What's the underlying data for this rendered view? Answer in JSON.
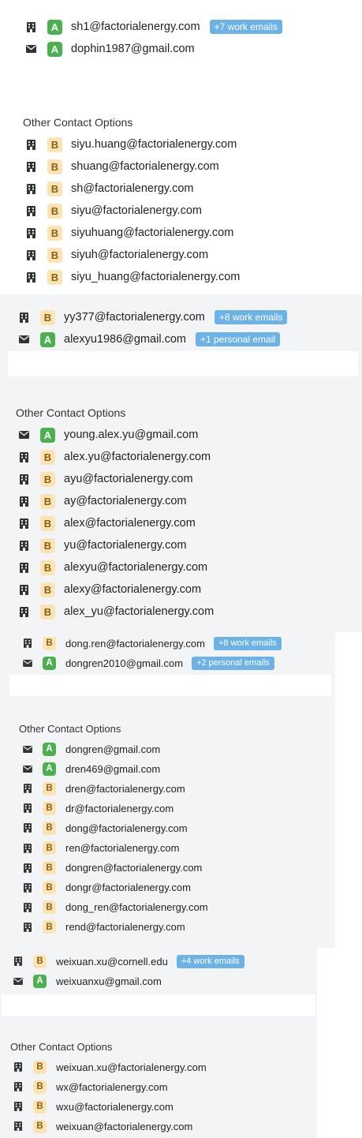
{
  "section_title": "Other Contact Options",
  "panels": [
    {
      "primary": [
        {
          "icon": "building-icon",
          "badge": "A",
          "email": "sh1@factorialenergy.com",
          "pill": "+7 work emails"
        },
        {
          "icon": "envelope-icon",
          "badge": "A",
          "email": "dophin1987@gmail.com",
          "pill": ""
        }
      ],
      "other": [
        {
          "icon": "building-icon",
          "badge": "B",
          "email": "siyu.huang@factorialenergy.com"
        },
        {
          "icon": "building-icon",
          "badge": "B",
          "email": "shuang@factorialenergy.com"
        },
        {
          "icon": "building-icon",
          "badge": "B",
          "email": "sh@factorialenergy.com"
        },
        {
          "icon": "building-icon",
          "badge": "B",
          "email": "siyu@factorialenergy.com"
        },
        {
          "icon": "building-icon",
          "badge": "B",
          "email": "siyuhuang@factorialenergy.com"
        },
        {
          "icon": "building-icon",
          "badge": "B",
          "email": "siyuh@factorialenergy.com"
        },
        {
          "icon": "building-icon",
          "badge": "B",
          "email": "siyu_huang@factorialenergy.com"
        }
      ]
    },
    {
      "primary": [
        {
          "icon": "building-icon",
          "badge": "B",
          "email": "yy377@factorialenergy.com",
          "pill": "+8 work emails"
        },
        {
          "icon": "envelope-icon",
          "badge": "A",
          "email": "alexyu1986@gmail.com",
          "pill": "+1 personal email"
        }
      ],
      "other": [
        {
          "icon": "envelope-icon",
          "badge": "A",
          "email": "young.alex.yu@gmail.com"
        },
        {
          "icon": "building-icon",
          "badge": "B",
          "email": "alex.yu@factorialenergy.com"
        },
        {
          "icon": "building-icon",
          "badge": "B",
          "email": "ayu@factorialenergy.com"
        },
        {
          "icon": "building-icon",
          "badge": "B",
          "email": "ay@factorialenergy.com"
        },
        {
          "icon": "building-icon",
          "badge": "B",
          "email": "alex@factorialenergy.com"
        },
        {
          "icon": "building-icon",
          "badge": "B",
          "email": "yu@factorialenergy.com"
        },
        {
          "icon": "building-icon",
          "badge": "B",
          "email": "alexyu@factorialenergy.com"
        },
        {
          "icon": "building-icon",
          "badge": "B",
          "email": "alexy@factorialenergy.com"
        },
        {
          "icon": "building-icon",
          "badge": "B",
          "email": "alex_yu@factorialenergy.com"
        }
      ]
    },
    {
      "primary": [
        {
          "icon": "building-icon",
          "badge": "B",
          "email": "dong.ren@factorialenergy.com",
          "pill": "+8 work emails"
        },
        {
          "icon": "envelope-icon",
          "badge": "A",
          "email": "dongren2010@gmail.com",
          "pill": "+2 personal emails"
        }
      ],
      "other": [
        {
          "icon": "envelope-icon",
          "badge": "A",
          "email": "dongren@gmail.com"
        },
        {
          "icon": "envelope-icon",
          "badge": "A",
          "email": "dren469@gmail.com"
        },
        {
          "icon": "building-icon",
          "badge": "B",
          "email": "dren@factorialenergy.com"
        },
        {
          "icon": "building-icon",
          "badge": "B",
          "email": "dr@factorialenergy.com"
        },
        {
          "icon": "building-icon",
          "badge": "B",
          "email": "dong@factorialenergy.com"
        },
        {
          "icon": "building-icon",
          "badge": "B",
          "email": "ren@factorialenergy.com"
        },
        {
          "icon": "building-icon",
          "badge": "B",
          "email": "dongren@factorialenergy.com"
        },
        {
          "icon": "building-icon",
          "badge": "B",
          "email": "dongr@factorialenergy.com"
        },
        {
          "icon": "building-icon",
          "badge": "B",
          "email": "dong_ren@factorialenergy.com"
        },
        {
          "icon": "building-icon",
          "badge": "B",
          "email": "rend@factorialenergy.com"
        }
      ]
    },
    {
      "primary": [
        {
          "icon": "building-icon",
          "badge": "B",
          "email": "weixuan.xu@cornell.edu",
          "pill": "+4 work emails"
        },
        {
          "icon": "envelope-icon",
          "badge": "A",
          "email": "weixuanxu@gmail.com",
          "pill": ""
        }
      ],
      "other": [
        {
          "icon": "building-icon",
          "badge": "B",
          "email": "weixuan.xu@factorialenergy.com"
        },
        {
          "icon": "building-icon",
          "badge": "B",
          "email": "wx@factorialenergy.com"
        },
        {
          "icon": "building-icon",
          "badge": "B",
          "email": "wxu@factorialenergy.com"
        },
        {
          "icon": "building-icon",
          "badge": "B",
          "email": "weixuan@factorialenergy.com"
        }
      ]
    }
  ],
  "colors": {
    "badge_a_bg": "#4caf50",
    "badge_b_bg": "#fbe3b3",
    "pill_bg": "#6cb2e6",
    "panel_bg": "#f3f4f6"
  }
}
